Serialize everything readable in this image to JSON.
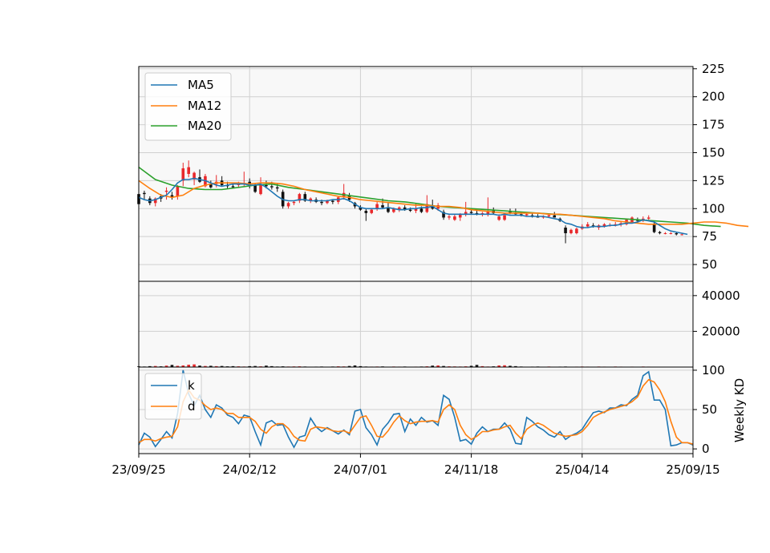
{
  "chart_data": [
    {
      "type": "candlestick",
      "panel": "price",
      "ylim": [
        35,
        227
      ],
      "yticks": [
        50,
        75,
        100,
        125,
        150,
        175,
        200,
        225
      ],
      "grid": true,
      "legend_position": "upper-left",
      "x_tick_labels": [
        "23/09/25",
        "24/02/12",
        "24/07/01",
        "24/11/18",
        "25/04/14",
        "25/09/15"
      ],
      "x_tick_weeks": [
        0,
        20,
        40,
        60,
        80,
        100
      ],
      "colors": {
        "up": "#e8282b",
        "down": "#111111",
        "ma5": "#1f77b4",
        "ma12": "#ff7f0e",
        "ma20": "#2ca02c"
      },
      "series": [
        {
          "name": "MA5",
          "color": "#1f77b4"
        },
        {
          "name": "MA12",
          "color": "#ff7f0e"
        },
        {
          "name": "MA20",
          "color": "#2ca02c"
        }
      ],
      "candles": [
        {
          "o": 113,
          "h": 115,
          "l": 103,
          "c": 104
        },
        {
          "o": 114,
          "h": 116,
          "l": 108,
          "c": 113
        },
        {
          "o": 109,
          "h": 111,
          "l": 103,
          "c": 105
        },
        {
          "o": 105,
          "h": 110,
          "l": 102,
          "c": 109
        },
        {
          "o": 111,
          "h": 113,
          "l": 106,
          "c": 109
        },
        {
          "o": 115,
          "h": 119,
          "l": 108,
          "c": 116
        },
        {
          "o": 112,
          "h": 115,
          "l": 108,
          "c": 110
        },
        {
          "o": 111,
          "h": 121,
          "l": 108,
          "c": 120
        },
        {
          "o": 125,
          "h": 141,
          "l": 120,
          "c": 136
        },
        {
          "o": 131,
          "h": 143,
          "l": 128,
          "c": 137
        },
        {
          "o": 126,
          "h": 133,
          "l": 121,
          "c": 132
        },
        {
          "o": 128,
          "h": 135,
          "l": 123,
          "c": 124
        },
        {
          "o": 120,
          "h": 131,
          "l": 119,
          "c": 129
        },
        {
          "o": 122,
          "h": 125,
          "l": 118,
          "c": 119
        },
        {
          "o": 122,
          "h": 130,
          "l": 119,
          "c": 124
        },
        {
          "o": 125,
          "h": 129,
          "l": 120,
          "c": 121
        },
        {
          "o": 121,
          "h": 124,
          "l": 118,
          "c": 120
        },
        {
          "o": 120,
          "h": 123,
          "l": 118,
          "c": 119
        },
        {
          "o": 121,
          "h": 124,
          "l": 119,
          "c": 122
        },
        {
          "o": 122,
          "h": 133,
          "l": 120,
          "c": 123
        },
        {
          "o": 124,
          "h": 127,
          "l": 118,
          "c": 121
        },
        {
          "o": 121,
          "h": 122,
          "l": 114,
          "c": 115
        },
        {
          "o": 113,
          "h": 128,
          "l": 112,
          "c": 121
        },
        {
          "o": 121,
          "h": 125,
          "l": 118,
          "c": 120
        },
        {
          "o": 120,
          "h": 124,
          "l": 117,
          "c": 119
        },
        {
          "o": 119,
          "h": 122,
          "l": 115,
          "c": 118
        },
        {
          "o": 115,
          "h": 117,
          "l": 100,
          "c": 102
        },
        {
          "o": 102,
          "h": 106,
          "l": 100,
          "c": 105
        },
        {
          "o": 105,
          "h": 107,
          "l": 103,
          "c": 106
        },
        {
          "o": 107,
          "h": 114,
          "l": 105,
          "c": 113
        },
        {
          "o": 113,
          "h": 115,
          "l": 106,
          "c": 107
        },
        {
          "o": 107,
          "h": 110,
          "l": 105,
          "c": 109
        },
        {
          "o": 108,
          "h": 110,
          "l": 105,
          "c": 106
        },
        {
          "o": 106,
          "h": 108,
          "l": 103,
          "c": 105
        },
        {
          "o": 105,
          "h": 108,
          "l": 104,
          "c": 107
        },
        {
          "o": 107,
          "h": 108,
          "l": 104,
          "c": 106
        },
        {
          "o": 106,
          "h": 111,
          "l": 104,
          "c": 110
        },
        {
          "o": 110,
          "h": 122,
          "l": 108,
          "c": 114
        },
        {
          "o": 112,
          "h": 114,
          "l": 106,
          "c": 108
        },
        {
          "o": 105,
          "h": 106,
          "l": 100,
          "c": 102
        },
        {
          "o": 101,
          "h": 103,
          "l": 98,
          "c": 99
        },
        {
          "o": 98,
          "h": 100,
          "l": 89,
          "c": 96
        },
        {
          "o": 96,
          "h": 100,
          "l": 95,
          "c": 99
        },
        {
          "o": 100,
          "h": 106,
          "l": 98,
          "c": 104
        },
        {
          "o": 103,
          "h": 109,
          "l": 100,
          "c": 101
        },
        {
          "o": 101,
          "h": 105,
          "l": 96,
          "c": 97
        },
        {
          "o": 97,
          "h": 101,
          "l": 96,
          "c": 100
        },
        {
          "o": 99,
          "h": 102,
          "l": 97,
          "c": 101
        },
        {
          "o": 101,
          "h": 103,
          "l": 98,
          "c": 99
        },
        {
          "o": 99,
          "h": 101,
          "l": 97,
          "c": 98
        },
        {
          "o": 98,
          "h": 105,
          "l": 96,
          "c": 100
        },
        {
          "o": 100,
          "h": 102,
          "l": 96,
          "c": 97
        },
        {
          "o": 97,
          "h": 112,
          "l": 96,
          "c": 104
        },
        {
          "o": 103,
          "h": 108,
          "l": 99,
          "c": 100
        },
        {
          "o": 100,
          "h": 105,
          "l": 98,
          "c": 103
        },
        {
          "o": 97,
          "h": 99,
          "l": 90,
          "c": 92
        },
        {
          "o": 92,
          "h": 95,
          "l": 90,
          "c": 93
        },
        {
          "o": 90,
          "h": 95,
          "l": 89,
          "c": 93
        },
        {
          "o": 92,
          "h": 96,
          "l": 89,
          "c": 95
        },
        {
          "o": 95,
          "h": 106,
          "l": 93,
          "c": 97
        },
        {
          "o": 97,
          "h": 99,
          "l": 95,
          "c": 96
        },
        {
          "o": 96,
          "h": 98,
          "l": 94,
          "c": 95
        },
        {
          "o": 95,
          "h": 97,
          "l": 93,
          "c": 96
        },
        {
          "o": 95,
          "h": 110,
          "l": 93,
          "c": 97
        },
        {
          "o": 98,
          "h": 101,
          "l": 95,
          "c": 96
        },
        {
          "o": 90,
          "h": 95,
          "l": 89,
          "c": 93
        },
        {
          "o": 90,
          "h": 96,
          "l": 89,
          "c": 94
        },
        {
          "o": 97,
          "h": 100,
          "l": 95,
          "c": 96
        },
        {
          "o": 96,
          "h": 100,
          "l": 94,
          "c": 95
        },
        {
          "o": 95,
          "h": 97,
          "l": 93,
          "c": 94
        },
        {
          "o": 94,
          "h": 96,
          "l": 93,
          "c": 95
        },
        {
          "o": 94,
          "h": 96,
          "l": 92,
          "c": 93
        },
        {
          "o": 93,
          "h": 95,
          "l": 92,
          "c": 92
        },
        {
          "o": 92,
          "h": 94,
          "l": 91,
          "c": 93
        },
        {
          "o": 93,
          "h": 95,
          "l": 92,
          "c": 94
        },
        {
          "o": 94,
          "h": 97,
          "l": 92,
          "c": 92
        },
        {
          "o": 91,
          "h": 92,
          "l": 88,
          "c": 89
        },
        {
          "o": 83,
          "h": 85,
          "l": 69,
          "c": 78
        },
        {
          "o": 78,
          "h": 82,
          "l": 77,
          "c": 81
        },
        {
          "o": 78,
          "h": 83,
          "l": 77,
          "c": 82
        },
        {
          "o": 82,
          "h": 86,
          "l": 81,
          "c": 84
        },
        {
          "o": 84,
          "h": 88,
          "l": 83,
          "c": 86
        },
        {
          "o": 85,
          "h": 87,
          "l": 83,
          "c": 84
        },
        {
          "o": 83,
          "h": 86,
          "l": 81,
          "c": 85
        },
        {
          "o": 84,
          "h": 87,
          "l": 83,
          "c": 86
        },
        {
          "o": 85,
          "h": 87,
          "l": 84,
          "c": 85
        },
        {
          "o": 85,
          "h": 88,
          "l": 84,
          "c": 86
        },
        {
          "o": 86,
          "h": 88,
          "l": 84,
          "c": 87
        },
        {
          "o": 86,
          "h": 91,
          "l": 85,
          "c": 90
        },
        {
          "o": 88,
          "h": 93,
          "l": 87,
          "c": 92
        },
        {
          "o": 90,
          "h": 92,
          "l": 88,
          "c": 89
        },
        {
          "o": 89,
          "h": 93,
          "l": 88,
          "c": 91
        },
        {
          "o": 91,
          "h": 94,
          "l": 90,
          "c": 92
        },
        {
          "o": 86,
          "h": 88,
          "l": 78,
          "c": 79
        },
        {
          "o": 79,
          "h": 80,
          "l": 77,
          "c": 78
        },
        {
          "o": 78,
          "h": 79,
          "l": 77,
          "c": 78
        },
        {
          "o": 78,
          "h": 79,
          "l": 77,
          "c": 78
        },
        {
          "o": 78,
          "h": 79,
          "l": 76,
          "c": 77
        },
        {
          "o": 77,
          "h": 78,
          "l": 76,
          "c": 77
        }
      ],
      "ma5": [
        110,
        108,
        107,
        108,
        110,
        112,
        117,
        123,
        126,
        126,
        127,
        126,
        125,
        123,
        121,
        120,
        121,
        122,
        122,
        122,
        121,
        121,
        122,
        119,
        115,
        111,
        108,
        107,
        107,
        108,
        108,
        107,
        107,
        107,
        107,
        108,
        108,
        109,
        107,
        104,
        101,
        100,
        100,
        100,
        100,
        101,
        100,
        99,
        99,
        100,
        100,
        101,
        101,
        102,
        99,
        96,
        95,
        95,
        95,
        95,
        95,
        95,
        95,
        95,
        95,
        94,
        95,
        94,
        94,
        94,
        93,
        93,
        93,
        93,
        92,
        91,
        90,
        87,
        86,
        84,
        83,
        83,
        84,
        84,
        84,
        85,
        85,
        86,
        87,
        87,
        88,
        90,
        89,
        88,
        85,
        82,
        80,
        79,
        78,
        77
      ],
      "ma5_start_week": 0,
      "ma12": [
        125,
        118,
        112,
        110,
        112,
        118,
        121,
        123,
        123,
        123,
        122,
        123,
        123,
        122,
        120,
        117,
        115,
        113,
        111,
        110,
        108,
        107,
        106,
        105,
        104,
        103,
        103,
        102,
        102,
        101,
        99,
        98,
        97,
        96,
        96,
        96,
        96,
        95,
        95,
        94,
        93,
        92,
        91,
        89,
        88,
        87,
        86,
        86,
        86,
        86,
        87,
        88,
        88,
        87,
        85,
        84
      ],
      "ma12_step": 2,
      "ma20": [
        137,
        126,
        121,
        118,
        117,
        117,
        119,
        121,
        122,
        119,
        117,
        115,
        113,
        111,
        109,
        107,
        106,
        104,
        102,
        101,
        100,
        99,
        98,
        97,
        96,
        95,
        94,
        93,
        92,
        91,
        90,
        89,
        88,
        87,
        85,
        84
      ],
      "ma20_step": 3
    },
    {
      "type": "bar",
      "panel": "volume",
      "ylim": [
        0,
        48000
      ],
      "yticks": [
        20000,
        40000
      ],
      "grid": true,
      "volume": [
        400,
        300,
        500,
        600,
        400,
        800,
        1200,
        700,
        900,
        1300,
        1500,
        800,
        600,
        700,
        500,
        600,
        400,
        500,
        400,
        300,
        500,
        600,
        400,
        800,
        500,
        300,
        400,
        300,
        350,
        400,
        300,
        200,
        250,
        300,
        200,
        300,
        400,
        350,
        600,
        900,
        500,
        300,
        250,
        300,
        350,
        200,
        300,
        250,
        300,
        200,
        250,
        300,
        400,
        800,
        900,
        600,
        400,
        350,
        300,
        400,
        700,
        1200,
        500,
        300,
        400,
        900,
        1000,
        700,
        500,
        300,
        200,
        250,
        300,
        200,
        300,
        200,
        250,
        300,
        200,
        250,
        300,
        250,
        200,
        300,
        250,
        200,
        300,
        250,
        200,
        250,
        200,
        300,
        250,
        200,
        150,
        200,
        150,
        200,
        150,
        200
      ]
    },
    {
      "type": "line",
      "panel": "kd",
      "ylim": [
        -6,
        104
      ],
      "yticks": [
        0,
        50,
        100
      ],
      "ylabel": "Weekly KD",
      "grid": true,
      "legend_position": "upper-left",
      "series": [
        {
          "name": "k",
          "color": "#1f77b4",
          "values": [
            5,
            20,
            15,
            3,
            12,
            22,
            14,
            45,
            100,
            70,
            55,
            68,
            50,
            40,
            56,
            52,
            43,
            40,
            32,
            43,
            41,
            22,
            5,
            33,
            36,
            30,
            31,
            15,
            2,
            15,
            17,
            39,
            28,
            22,
            27,
            23,
            19,
            24,
            18,
            48,
            50,
            27,
            18,
            5,
            25,
            33,
            44,
            45,
            22,
            38,
            30,
            40,
            34,
            36,
            30,
            68,
            63,
            40,
            10,
            12,
            6,
            20,
            28,
            22,
            25,
            25,
            33,
            25,
            7,
            6,
            40,
            35,
            28,
            24,
            18,
            15,
            22,
            12,
            17,
            20,
            25,
            36,
            46,
            48,
            46,
            52,
            52,
            56,
            55,
            63,
            68,
            93,
            98,
            62,
            62,
            50,
            4,
            5,
            8,
            8,
            5
          ]
        },
        {
          "name": "d",
          "color": "#ff7f0e",
          "values": [
            8,
            12,
            12,
            10,
            13,
            15,
            16,
            28,
            60,
            75,
            65,
            62,
            55,
            50,
            52,
            50,
            45,
            45,
            40,
            40,
            40,
            35,
            25,
            20,
            28,
            32,
            32,
            26,
            16,
            11,
            10,
            25,
            28,
            27,
            26,
            23,
            22,
            23,
            20,
            30,
            40,
            42,
            30,
            16,
            15,
            23,
            34,
            42,
            36,
            32,
            34,
            35,
            35,
            36,
            34,
            50,
            56,
            50,
            30,
            18,
            12,
            16,
            22,
            22,
            24,
            25,
            28,
            30,
            20,
            13,
            25,
            30,
            33,
            30,
            25,
            20,
            18,
            16,
            17,
            18,
            22,
            30,
            40,
            44,
            47,
            50,
            52,
            54,
            56,
            60,
            66,
            80,
            88,
            85,
            75,
            60,
            35,
            15,
            8,
            8,
            6
          ]
        }
      ]
    }
  ]
}
